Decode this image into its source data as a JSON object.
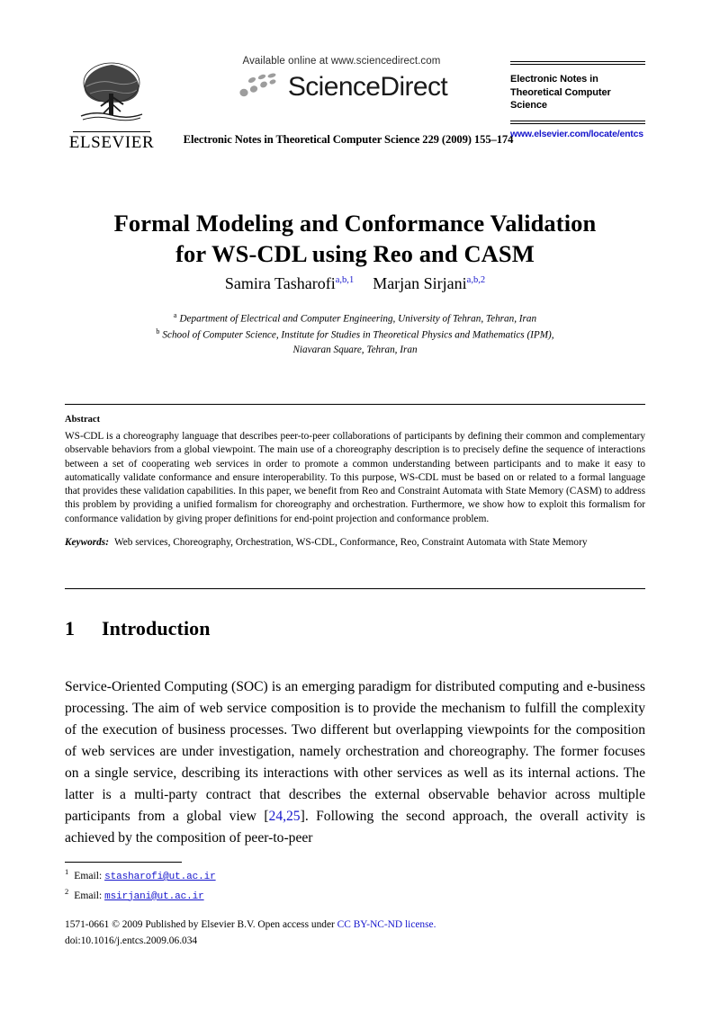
{
  "masthead": {
    "publisher_name": "ELSEVIER",
    "science_direct": {
      "available_line": "Available online at www.sciencedirect.com",
      "wordmark": "ScienceDirect"
    },
    "journal_reference": "Electronic Notes in Theoretical Computer Science 229 (2009) 155–174",
    "entcs_panel": {
      "title": "Electronic Notes in Theoretical Computer Science",
      "url": "www.elsevier.com/locate/entcs"
    }
  },
  "title": {
    "line1": "Formal Modeling and Conformance Validation",
    "line2": "for WS-CDL using Reo and CASM"
  },
  "authors": [
    {
      "name": "Samira Tasharofi",
      "affil_marks": "a,b,",
      "note_mark": "1"
    },
    {
      "name": "Marjan Sirjani",
      "affil_marks": "a,b,",
      "note_mark": "2"
    }
  ],
  "affiliations": [
    {
      "mark": "a",
      "text": "Department of Electrical and Computer Engineering, University of Tehran, Tehran, Iran"
    },
    {
      "mark": "b",
      "text": "School of Computer Science, Institute for Studies in Theoretical Physics and Mathematics (IPM),",
      "text_line2": "Niavaran Square, Tehran, Iran"
    }
  ],
  "abstract": {
    "label": "Abstract",
    "body": "WS-CDL is a choreography language that describes peer-to-peer collaborations of participants by defining their common and complementary observable behaviors from a global viewpoint. The main use of a choreography description is to precisely define the sequence of interactions between a set of cooperating web services in order to promote a common understanding between participants and to make it easy to automatically validate conformance and ensure interoperability. To this purpose, WS-CDL must be based on or related to a formal language that provides these validation capabilities. In this paper, we benefit from Reo and Constraint Automata with State Memory (CASM) to address this problem by providing a unified formalism for choreography and orchestration. Furthermore, we show how to exploit this formalism for conformance validation by giving proper definitions for end-point projection and conformance problem.",
    "keywords_label": "Keywords:",
    "keywords": "Web services, Choreography, Orchestration, WS-CDL, Conformance, Reo, Constraint Automata with State Memory"
  },
  "section": {
    "number": "1",
    "heading": "Introduction",
    "paragraph_part1": "Service-Oriented Computing (SOC) is an emerging paradigm for distributed computing and e-business processing. The aim of web service composition is to provide the mechanism to fulfill the complexity of the execution of business processes. Two different but overlapping viewpoints for the composition of web services are under investigation, namely orchestration and choreography. The former focuses on a single service, describing its interactions with other services as well as its internal actions. The latter is a multi-party contract that describes the external observable behavior across multiple participants from a global view ",
    "citation": "[24,25]",
    "citation_open": "[",
    "citation_numbers": "24,25",
    "citation_close": "]",
    "paragraph_part2": ". Following the second approach, the overall activity is achieved by the composition of peer-to-peer"
  },
  "footnotes": [
    {
      "number": "1",
      "label": "Email:",
      "email": "stasharofi@ut.ac.ir"
    },
    {
      "number": "2",
      "label": "Email:",
      "email": "msirjani@ut.ac.ir"
    }
  ],
  "footer": {
    "issn_line_prefix": "1571-0661 © 2009 Published by Elsevier B.V. Open access under ",
    "license_link": "CC BY-NC-ND license.",
    "doi": "doi:10.1016/j.entcs.2009.06.034"
  },
  "colors": {
    "link_blue": "#1515cc",
    "text_black": "#000000",
    "page_background": "#ffffff"
  }
}
